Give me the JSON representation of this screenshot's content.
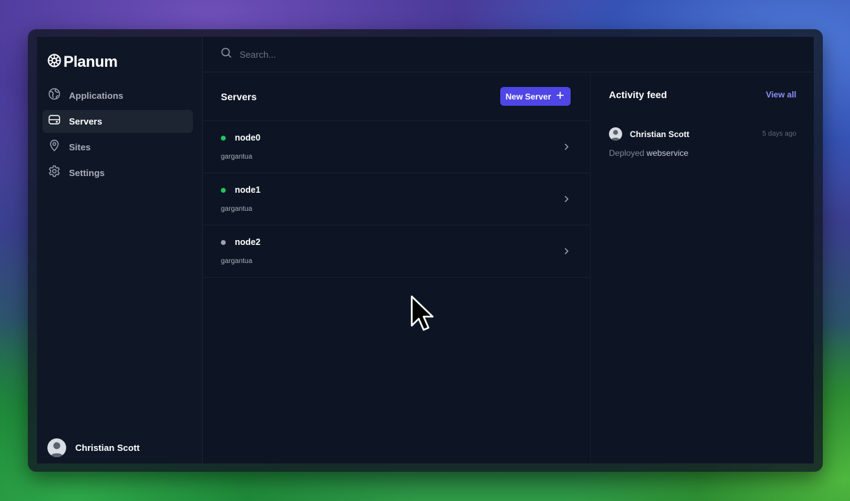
{
  "brand": {
    "name": "Planum"
  },
  "sidebar": {
    "items": [
      {
        "label": "Applications",
        "icon": "globe-icon",
        "active": false
      },
      {
        "label": "Servers",
        "icon": "server-icon",
        "active": true
      },
      {
        "label": "Sites",
        "icon": "map-pin-icon",
        "active": false
      },
      {
        "label": "Settings",
        "icon": "gear-icon",
        "active": false
      }
    ],
    "user": {
      "name": "Christian Scott"
    }
  },
  "search": {
    "placeholder": "Search..."
  },
  "servers": {
    "title": "Servers",
    "new_button_label": "New Server",
    "rows": [
      {
        "name": "node0",
        "host": "gargantua",
        "status_color": "#22c55e"
      },
      {
        "name": "node1",
        "host": "gargantua",
        "status_color": "#22c55e"
      },
      {
        "name": "node2",
        "host": "gargantua",
        "status_color": "#9ca3af"
      }
    ]
  },
  "activity": {
    "title": "Activity feed",
    "view_all_label": "View all",
    "items": [
      {
        "user": "Christian Scott",
        "time": "5 days ago",
        "action": "Deployed",
        "target": "webservice"
      }
    ]
  },
  "colors": {
    "accent": "#4f46e5",
    "link": "#8b8ff5",
    "online": "#22c55e",
    "offline": "#9ca3af"
  }
}
